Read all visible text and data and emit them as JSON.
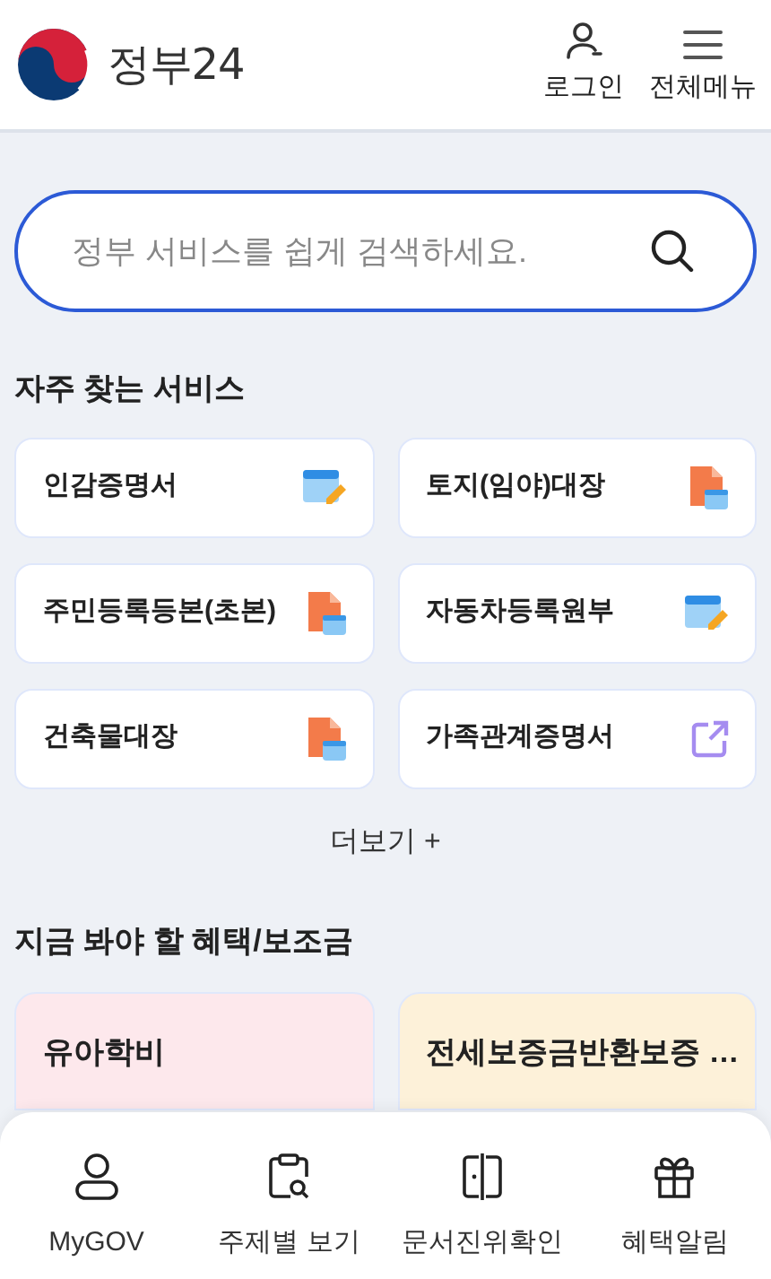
{
  "header": {
    "logo_text": "정부24",
    "actions": [
      {
        "kind": "login",
        "label": "로그인"
      },
      {
        "kind": "menu",
        "label": "전체메뉴"
      }
    ]
  },
  "search": {
    "placeholder": "정부 서비스를 쉽게 검색하세요."
  },
  "frequent": {
    "title": "자주 찾는 서비스",
    "items": [
      {
        "label": "인감증명서",
        "kind": "pc"
      },
      {
        "label": "토지(임야)대장",
        "kind": "pdf"
      },
      {
        "label": "주민등록등본(초본)",
        "kind": "pdf"
      },
      {
        "label": "자동차등록원부",
        "kind": "pc"
      },
      {
        "label": "건축물대장",
        "kind": "pdf"
      },
      {
        "label": "가족관계증명서",
        "kind": "link"
      }
    ],
    "more": "더보기 +"
  },
  "benefits": {
    "title": "지금 봐야 할 혜택/보조금",
    "items": [
      {
        "title": "유아학비",
        "color": "#fde8ec"
      },
      {
        "title": "전세보증금반환보증 …",
        "color": "#fdf1d9"
      }
    ]
  },
  "bottom_nav": [
    {
      "kind": "person",
      "label": "MyGOV"
    },
    {
      "kind": "topic",
      "label": "주제별 보기"
    },
    {
      "kind": "doc",
      "label": "문서진위확인"
    },
    {
      "kind": "gift",
      "label": "혜택알림"
    }
  ]
}
